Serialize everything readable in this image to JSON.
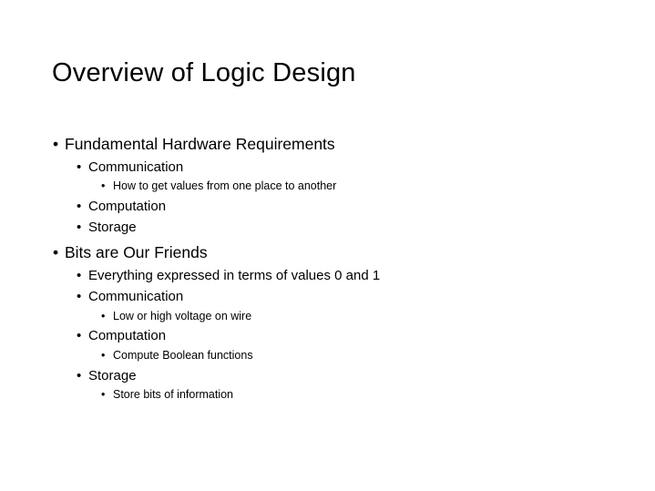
{
  "slide": {
    "title": "Overview of Logic Design",
    "bullet_char": "•",
    "items": [
      {
        "level": 1,
        "text": "Fundamental Hardware Requirements"
      },
      {
        "level": 2,
        "text": "Communication"
      },
      {
        "level": 3,
        "text": "How to get values from one place to another"
      },
      {
        "level": 2,
        "text": "Computation"
      },
      {
        "level": 2,
        "text": "Storage"
      },
      {
        "level": 1,
        "text": "Bits are Our Friends"
      },
      {
        "level": 2,
        "text": "Everything expressed in terms of values 0 and 1"
      },
      {
        "level": 2,
        "text": "Communication"
      },
      {
        "level": 3,
        "text": "Low or high voltage on wire"
      },
      {
        "level": 2,
        "text": "Computation"
      },
      {
        "level": 3,
        "text": "Compute Boolean functions"
      },
      {
        "level": 2,
        "text": "Storage"
      },
      {
        "level": 3,
        "text": "Store bits of information"
      }
    ]
  }
}
